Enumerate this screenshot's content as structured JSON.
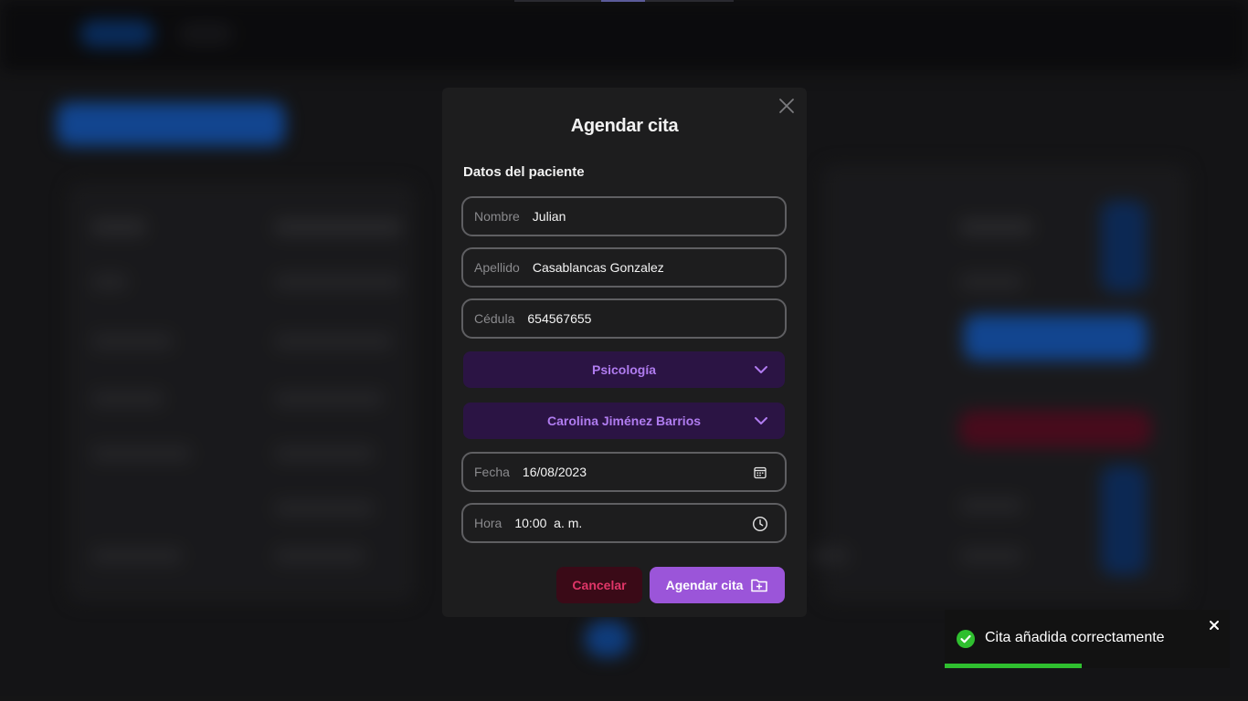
{
  "modal": {
    "title": "Agendar cita",
    "section_title": "Datos del paciente",
    "fields": {
      "nombre": {
        "label": "Nombre",
        "value": "Julian"
      },
      "apellido": {
        "label": "Apellido",
        "value": "Casablancas Gonzalez"
      },
      "cedula": {
        "label": "Cédula",
        "value": "654567655"
      },
      "fecha": {
        "label": "Fecha",
        "value": "16/08/2023"
      },
      "hora": {
        "label": "Hora",
        "value": "10:00  a. m."
      }
    },
    "selects": {
      "especialidad": {
        "value": "Psicología"
      },
      "doctor": {
        "value": "Carolina Jiménez Barrios"
      }
    },
    "buttons": {
      "cancel_label": "Cancelar",
      "submit_label": "Agendar cita"
    },
    "icons": {
      "close": "close-icon",
      "calendar": "calendar-icon",
      "clock": "clock-icon",
      "chevron": "chevron-down-icon",
      "folder_plus": "folder-plus-icon"
    }
  },
  "toast": {
    "message": "Cita añadida correctamente",
    "progress_fraction": 0.48,
    "icon": "check-circle-icon",
    "colors": {
      "success": "#2fbf2f"
    }
  },
  "colors": {
    "accent": "#9b55d9",
    "select_bg": "#2b1444",
    "select_text": "#b07cf0",
    "cancel_bg": "#3a0a17",
    "cancel_text": "#e03668"
  }
}
